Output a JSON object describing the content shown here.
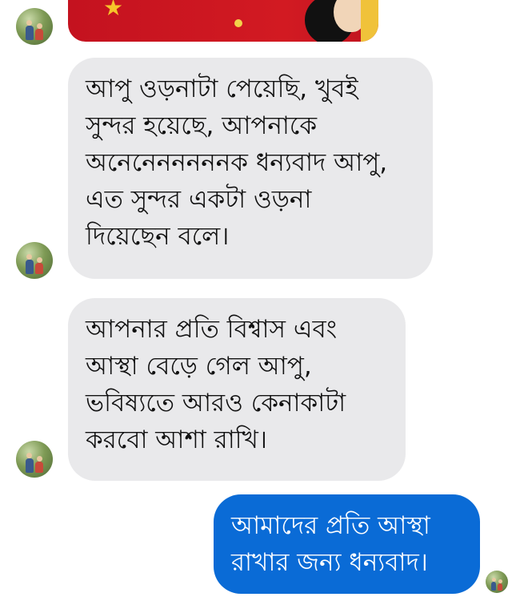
{
  "messages": [
    {
      "sender": "other",
      "type": "image",
      "image_description_icon": "shared-photo"
    },
    {
      "sender": "other",
      "type": "text",
      "text": "আপু ওড়নাটা পেয়েছি,  খুবই\nসুন্দর হয়েছে, আপনাকে\nঅনেনেনননননক ধন্যবাদ আপু,\nএত সুন্দর একটা ওড়না\nদিয়েছেন বলে।"
    },
    {
      "sender": "other",
      "type": "text",
      "text": "আপনার প্রতি বিশ্বাস এবং\nআস্থা বেড়ে গেল আপু,\nভবিষ্যতে আরও কেনাকাটা\nকরবো আশা রাখি।"
    },
    {
      "sender": "me",
      "type": "text",
      "text": "আমাদের প্রতি আস্থা\nরাখার জন্য ধন্যবাদ।"
    }
  ],
  "colors": {
    "incoming_bubble": "#e9e9eb",
    "outgoing_bubble": "#0a6bd6",
    "outgoing_text": "#ffffff",
    "incoming_text": "#111111"
  }
}
